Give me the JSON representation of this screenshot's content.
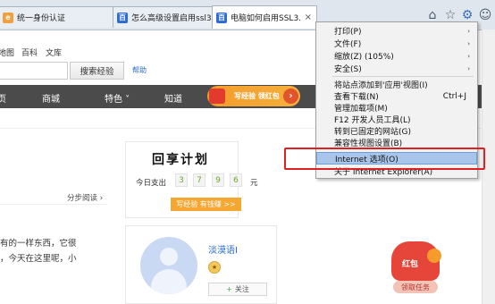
{
  "tabs": [
    {
      "label": "统一身份认证",
      "icon_color": "#f2a03d",
      "icon_glyph": "e"
    },
    {
      "label": "怎么高级设置启用ssl3...",
      "icon_color": "#2d6bd6",
      "icon_glyph": "百"
    },
    {
      "label": "电脑如何启用SSL3....",
      "icon_color": "#2d6bd6",
      "icon_glyph": "百",
      "close": "×"
    }
  ],
  "toolbar_icons": [
    "home-icon",
    "star-icon",
    "gear-icon",
    "smiley-icon"
  ],
  "site": {
    "nav_links": [
      "地图",
      "百科",
      "文库"
    ],
    "search_button": "搜索经验",
    "help_link": "帮助",
    "nav_items": [
      "页",
      "商城",
      "特色 ˅",
      "知道"
    ],
    "promo_text": "写经验 领红包",
    "step_read": "分步阅读 ›",
    "body_lines": [
      "有的一样东西，它很",
      "，今天在这里呢，小"
    ]
  },
  "plan_card": {
    "title": "回享计划",
    "spend_label": "今日支出",
    "digits": [
      "3",
      "7",
      "9",
      "6"
    ],
    "unit": "元",
    "button": "写经验 有钱赚 >>"
  },
  "user_card": {
    "name": "淡漠语I",
    "follow_label": "关注",
    "follow_plus": "+"
  },
  "red_packet": {
    "title": "红包",
    "task": "领取任务"
  },
  "tools_menu": {
    "items": [
      {
        "label": "打印(P)",
        "submenu": true
      },
      {
        "label": "文件(F)",
        "submenu": true
      },
      {
        "label": "缩放(Z) (105%)",
        "submenu": true
      },
      {
        "label": "安全(S)",
        "submenu": true
      },
      {
        "label": "将站点添加到'应用'视图(I)",
        "submenu": false
      },
      {
        "label": "查看下载(N)",
        "shortcut": "Ctrl+J"
      },
      {
        "label": "管理加载项(M)"
      },
      {
        "label": "F12 开发人员工具(L)"
      },
      {
        "label": "转到已固定的网站(G)"
      },
      {
        "label": "兼容性视图设置(B)"
      },
      {
        "label": "Internet 选项(O)",
        "highlighted": true
      },
      {
        "label": "关于 Internet Explorer(A)"
      }
    ]
  },
  "colors": {
    "highlight_box": "#e02020",
    "menu_highlight": "#a9c6ea",
    "accent_orange": "#f5a732"
  }
}
